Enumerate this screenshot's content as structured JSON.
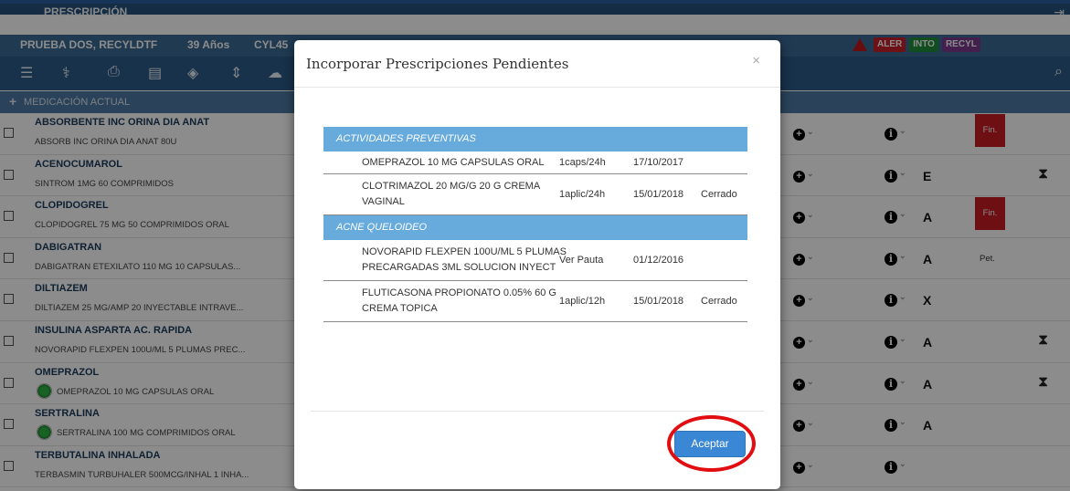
{
  "app": {
    "title": "PRESCRIPCIÓN",
    "patient": {
      "name": "PRUEBA DOS, RECYLDTF",
      "age": "39 Años",
      "code": "CYL45"
    },
    "alerts": [
      "ALER",
      "INTO",
      "RECYL"
    ],
    "section": "MEDICACIÓN ACTUAL"
  },
  "colors": {
    "header": "#25527c",
    "toolbar": "#2c5b89",
    "group": "#67aadc",
    "accept": "#3a87d6",
    "alert_red": "#c91d24",
    "ring": "#e10d10"
  },
  "medications": [
    {
      "name": "ABSORBENTE INC ORINA DIA ANAT",
      "desc": "ABSORB INC ORINA DIA ANAT 80U",
      "letter": "",
      "status": "Fin.",
      "pending": false,
      "dot": false
    },
    {
      "name": "ACENOCUMAROL",
      "desc": "SINTROM 1MG 60 COMPRIMIDOS",
      "letter": "E",
      "status": "",
      "pending": true,
      "dot": false
    },
    {
      "name": "CLOPIDOGREL",
      "desc": "CLOPIDOGREL 75 MG 50 COMPRIMIDOS ORAL",
      "letter": "A",
      "status": "Fin.",
      "pending": false,
      "dot": false
    },
    {
      "name": "DABIGATRAN",
      "desc": "DABIGATRAN ETEXILATO 110 MG 10 CAPSULAS...",
      "letter": "A",
      "status": "Pet.",
      "pending": false,
      "dot": false
    },
    {
      "name": "DILTIAZEM",
      "desc": "DILTIAZEM 25 MG/AMP 20 INYECTABLE INTRAVE...",
      "letter": "X",
      "status": "",
      "pending": false,
      "dot": false
    },
    {
      "name": "INSULINA ASPARTA AC. RAPIDA",
      "desc": "NOVORAPID FLEXPEN 100U/ML 5 PLUMAS PREC...",
      "letter": "A",
      "status": "",
      "pending": true,
      "dot": false
    },
    {
      "name": "OMEPRAZOL",
      "desc": "OMEPRAZOL 10 MG CAPSULAS ORAL",
      "letter": "A",
      "status": "",
      "pending": true,
      "dot": true
    },
    {
      "name": "SERTRALINA",
      "desc": "SERTRALINA 100 MG COMPRIMIDOS ORAL",
      "letter": "A",
      "status": "",
      "pending": false,
      "dot": true
    },
    {
      "name": "TERBUTALINA INHALADA",
      "desc": "TERBASMIN TURBUHALER 500MCG/INHAL 1 INHA...",
      "letter": "",
      "status": "",
      "pending": false,
      "dot": false
    }
  ],
  "modal": {
    "title": "Incorporar Prescripciones Pendientes",
    "close": "×",
    "accept_label": "Aceptar",
    "groups": [
      {
        "name": "ACTIVIDADES PREVENTIVAS",
        "rows": [
          {
            "name": [
              "OMEPRAZOL 10 MG CAPSULAS ORAL"
            ],
            "dose": "1caps/24h",
            "date": "17/10/2017",
            "state": ""
          },
          {
            "name": [
              "CLOTRIMAZOL 20 MG/G 20 G CREMA",
              "VAGINAL"
            ],
            "dose": "1aplic/24h",
            "date": "15/01/2018",
            "state": "Cerrado"
          }
        ]
      },
      {
        "name": "ACNE QUELOIDEO",
        "rows": [
          {
            "name": [
              "NOVORAPID FLEXPEN 100U/ML 5 PLUMAS",
              "PRECARGADAS 3ML SOLUCION INYECT"
            ],
            "dose": "Ver Pauta",
            "date": "01/12/2016",
            "state": ""
          },
          {
            "name": [
              "FLUTICASONA PROPIONATO 0.05% 60 G",
              "CREMA TOPICA"
            ],
            "dose": "1aplic/12h",
            "date": "15/01/2018",
            "state": "Cerrado"
          }
        ]
      }
    ]
  }
}
